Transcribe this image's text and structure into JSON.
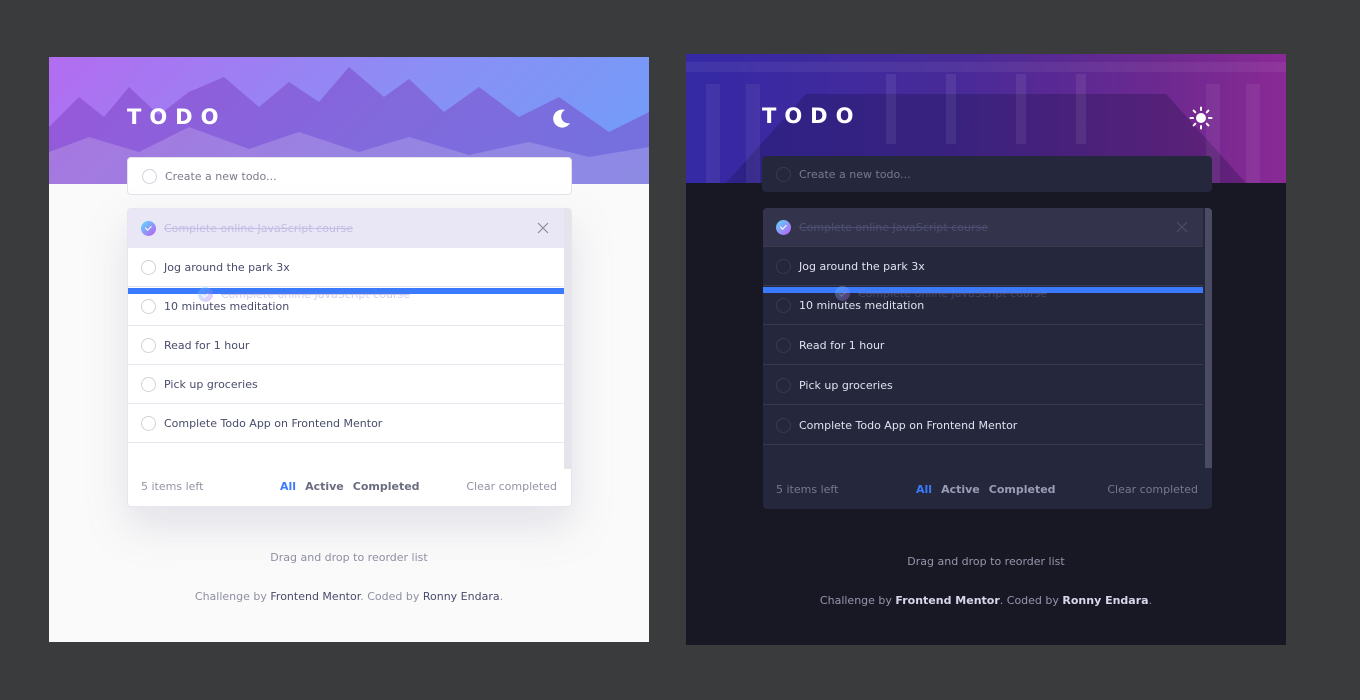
{
  "app": {
    "title": "TODO",
    "input_placeholder": "Create a new todo...",
    "items": [
      {
        "text": "Complete online JavaScript course",
        "completed": true
      },
      {
        "text": "Jog around the park 3x",
        "completed": false
      },
      {
        "text": "10 minutes meditation",
        "completed": false
      },
      {
        "text": "Read for 1 hour",
        "completed": false
      },
      {
        "text": "Pick up groceries",
        "completed": false
      },
      {
        "text": "Complete Todo App on Frontend Mentor",
        "completed": false
      }
    ],
    "dragged_item_text": "Complete online JavaScript course",
    "items_left": "5 items left",
    "filters": [
      "All",
      "Active",
      "Completed"
    ],
    "active_filter": "All",
    "clear_completed": "Clear completed",
    "drag_hint": "Drag and drop to reorder list",
    "attribution": {
      "prefix": "Challenge by ",
      "org": "Frontend Mentor",
      "middle": ". Coded by ",
      "author": "Ronny Endara",
      "suffix": "."
    }
  },
  "themes": {
    "light": {
      "toggle_icon": "moon-icon",
      "accent": "#3a7bfd",
      "background": "#fafafa"
    },
    "dark": {
      "toggle_icon": "sun-icon",
      "accent": "#3a7bfd",
      "background": "#181824"
    }
  }
}
